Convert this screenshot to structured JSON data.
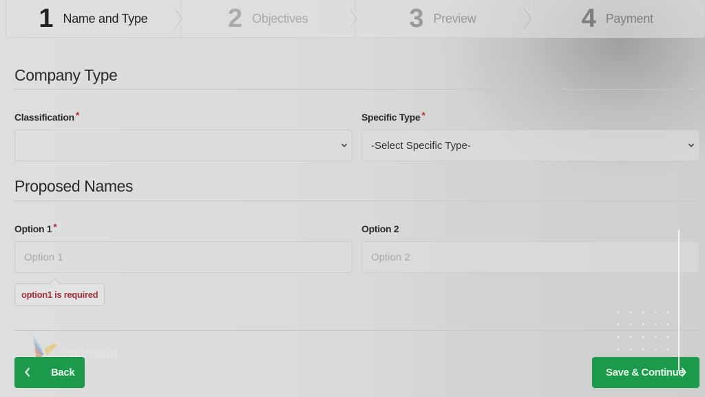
{
  "stepper": {
    "steps": [
      {
        "number": "1",
        "label": "Name and Type",
        "state": "active"
      },
      {
        "number": "2",
        "label": "Objectives",
        "state": "inactive"
      },
      {
        "number": "3",
        "label": "Preview",
        "state": "inactive"
      },
      {
        "number": "4",
        "label": "Payment",
        "state": "inactive"
      }
    ]
  },
  "company_type": {
    "title": "Company Type",
    "classification": {
      "label": "Classification",
      "required_mark": "*",
      "selected": ""
    },
    "specific_type": {
      "label": "Specific Type",
      "required_mark": "*",
      "selected": "-Select Specific Type-"
    }
  },
  "proposed_names": {
    "title": "Proposed Names",
    "option1": {
      "label": "Option 1",
      "required_mark": "*",
      "value": "",
      "placeholder": "Option 1",
      "error": "option1 is required"
    },
    "option2": {
      "label": "Option 2",
      "value": "",
      "placeholder": "Option 2"
    }
  },
  "actions": {
    "back_label": "Back",
    "save_label": "Save & Continue"
  },
  "watermark": {
    "text": "counseel"
  },
  "colors": {
    "primary_green": "#1a9a4a",
    "error_red": "#a0323b",
    "required_red": "#b0303a"
  }
}
